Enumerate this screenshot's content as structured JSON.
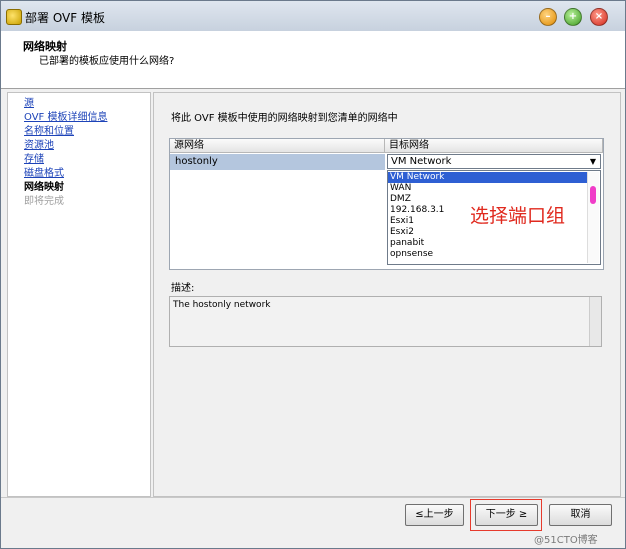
{
  "window": {
    "title": "部署 OVF 模板",
    "min_glyph": "–",
    "max_glyph": "+",
    "close_glyph": "×"
  },
  "header": {
    "title": "网络映射",
    "subtitle": "已部署的模板应使用什么网络?"
  },
  "nav": {
    "items": [
      {
        "label": "源",
        "state": "link"
      },
      {
        "label": "OVF 模板详细信息",
        "state": "link"
      },
      {
        "label": "名称和位置",
        "state": "link"
      },
      {
        "label": "资源池",
        "state": "link"
      },
      {
        "label": "存储",
        "state": "link"
      },
      {
        "label": "磁盘格式",
        "state": "link"
      },
      {
        "label": "网络映射",
        "state": "current"
      },
      {
        "label": "即将完成",
        "state": "disabled"
      }
    ]
  },
  "main": {
    "instruction": "将此 OVF 模板中使用的网络映射到您清单的网络中",
    "table": {
      "columns": [
        "源网络",
        "目标网络"
      ],
      "row": {
        "source": "hostonly",
        "target": "VM Network"
      }
    },
    "dropdown": {
      "arrow_glyph": "▼",
      "options": [
        "VM Network",
        "WAN",
        "DMZ",
        "192.168.3.1",
        "Esxi1",
        "Esxi2",
        "panabit",
        "opnsense"
      ],
      "selected": "VM Network"
    },
    "annotation": "选择端口组",
    "description_label": "描述:",
    "description": "The hostonly network"
  },
  "footer": {
    "prev": "≤上一步",
    "next": "下一步 ≥",
    "cancel": "取消"
  },
  "watermark": "@51CTO博客",
  "colors": {
    "selection": "#2e5fd3",
    "source_cell": "#b4c6de",
    "annotation": "#e0291e",
    "link": "#1d43b8"
  }
}
